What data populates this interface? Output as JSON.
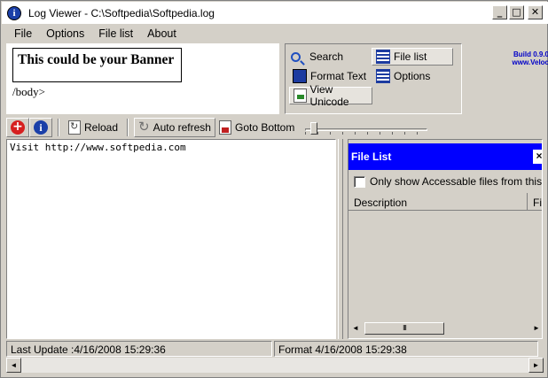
{
  "window": {
    "title": "Log Viewer - C:\\Softpedia\\Softpedia.log",
    "app_icon_glyph": "i",
    "controls": {
      "minimize": "_",
      "maximize": "□",
      "close": "✕"
    }
  },
  "menu": [
    "File",
    "Options",
    "File list",
    "About"
  ],
  "banner": {
    "text": "This could be your Banner",
    "body_tag": "/body>"
  },
  "commands": {
    "search": "Search",
    "file_list": "File list",
    "format_text": "Format Text",
    "options": "Options",
    "view_unicode": "View Unicode"
  },
  "build": {
    "version": "Build 0.9.0",
    "url": "www.Veloc"
  },
  "toolbar": {
    "add_glyph": "+",
    "info_glyph": "i",
    "reload": "Reload",
    "auto_refresh": "Auto refresh",
    "goto_bottom": "Goto Bottom",
    "refresh_glyph": "↻"
  },
  "log": {
    "lines": [
      "Visit http://www.softpedia.com"
    ]
  },
  "file_list_panel": {
    "title": "File List",
    "close_glyph": "×",
    "only_accessible_label": "Only show Accessable files from this PC",
    "columns": [
      "Description",
      "File"
    ],
    "scroll_thumb_glyph": "III",
    "scroll_left": "◄",
    "scroll_right": "►"
  },
  "status": {
    "last_update": "Last Update :4/16/2008 15:29:36",
    "format": "Format 4/16/2008 15:29:38"
  },
  "bottom_scroll": {
    "left": "◄",
    "right": "►"
  },
  "colors": {
    "file_list_header": "#0000ff",
    "build_text": "#0000c8",
    "window_bg": "#d4d0c8"
  }
}
